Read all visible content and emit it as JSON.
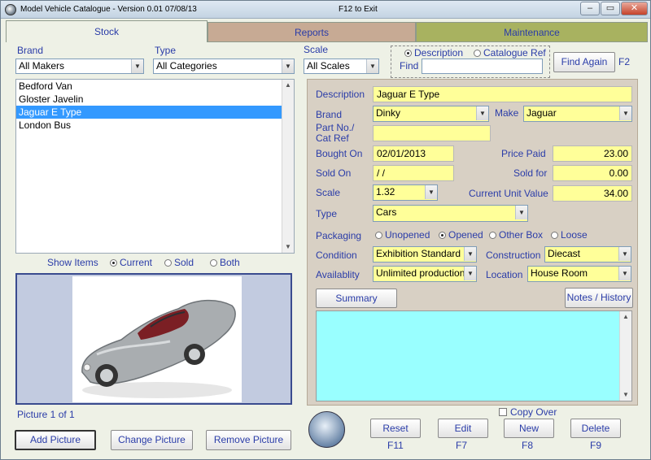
{
  "window": {
    "title": "Model Vehicle Catalogue - Version 0.01  07/08/13",
    "hint": "F12 to Exit",
    "controls": {
      "minimize": "–",
      "maximize": "▭",
      "close": "✕"
    }
  },
  "tabs": [
    {
      "label": "Stock"
    },
    {
      "label": "Reports"
    },
    {
      "label": "Maintenance"
    }
  ],
  "filters": {
    "brand_label": "Brand",
    "brand_value": "All Makers",
    "type_label": "Type",
    "type_value": "All Categories",
    "scale_label": "Scale",
    "scale_value": "All Scales"
  },
  "search": {
    "option_description": "Description",
    "option_catalogue_ref": "Catalogue Ref",
    "find_label": "Find",
    "find_value": "",
    "find_again_label": "Find Again",
    "find_again_shortcut": "F2"
  },
  "vehicles": [
    {
      "name": "Bedford Van",
      "selected": false
    },
    {
      "name": "Gloster Javelin",
      "selected": false
    },
    {
      "name": "Jaguar E Type",
      "selected": true
    },
    {
      "name": "London Bus",
      "selected": false
    }
  ],
  "show_items": {
    "label": "Show Items",
    "options": [
      "Current",
      "Sold",
      "Both"
    ],
    "selected": "Current"
  },
  "picture": {
    "counter": "Picture 1 of 1",
    "add_label": "Add Picture",
    "change_label": "Change Picture",
    "remove_label": "Remove Picture"
  },
  "details": {
    "description_label": "Description",
    "description_value": "Jaguar E Type",
    "brand_label": "Brand",
    "brand_value": "Dinky",
    "make_label": "Make",
    "make_value": "Jaguar",
    "part_no_label": "Part No./",
    "cat_ref_label": "Cat Ref",
    "part_no_value": "",
    "bought_on_label": "Bought On",
    "bought_on_value": "02/01/2013",
    "price_paid_label": "Price Paid",
    "price_paid_value": "23.00",
    "sold_on_label": "Sold On",
    "sold_on_value": " / /",
    "sold_for_label": "Sold for",
    "sold_for_value": "0.00",
    "scale_label": "Scale",
    "scale_value": "1.32",
    "current_value_label": "Current Unit Value",
    "current_value_value": "34.00",
    "type_label": "Type",
    "type_value": "Cars",
    "packaging_label": "Packaging",
    "packaging_options": [
      "Unopened",
      "Opened",
      "Other Box",
      "Loose"
    ],
    "packaging_selected": "Opened",
    "condition_label": "Condition",
    "condition_value": "Exhibition Standard",
    "construction_label": "Construction",
    "construction_value": "Diecast",
    "availability_label": "Availablity",
    "availability_value": "Unlimited production",
    "location_label": "Location",
    "location_value": "House Room",
    "summary_label": "Summary",
    "notes_label": "Notes / History",
    "summary_text": ""
  },
  "actions": {
    "copy_over_label": "Copy Over",
    "reset_label": "Reset",
    "reset_key": "F11",
    "edit_label": "Edit",
    "edit_key": "F7",
    "new_label": "New",
    "new_key": "F8",
    "delete_label": "Delete",
    "delete_key": "F9"
  },
  "colors": {
    "label_blue": "#2a3ca8",
    "field_yellow": "#ffff99",
    "summary_cyan": "#99ffff",
    "reports_tab": "#c7aa94",
    "maintenance_tab": "#a8b260",
    "selection_blue": "#3399ff"
  }
}
